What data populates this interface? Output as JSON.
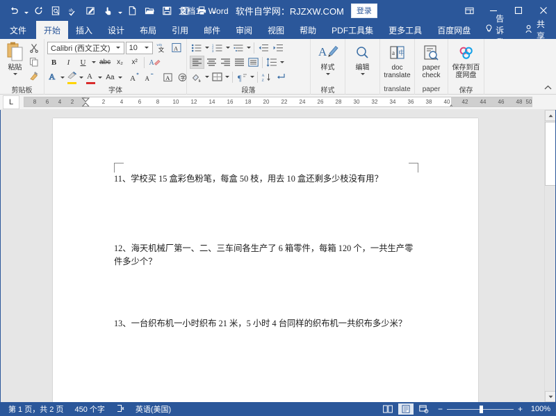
{
  "titlebar": {
    "quick_access": [
      {
        "name": "undo-icon",
        "label": "撤销"
      },
      {
        "name": "undo-dropdown-icon",
        "label": "撤销下拉"
      },
      {
        "name": "redo-icon",
        "label": "重复"
      },
      {
        "name": "print-preview-icon",
        "label": "打印预览"
      },
      {
        "name": "spelling-check-icon",
        "label": "拼写检查"
      },
      {
        "name": "edit-icon",
        "label": "编辑"
      },
      {
        "name": "touch-mode-icon",
        "label": "触摸模式"
      },
      {
        "name": "touch-dropdown-icon",
        "label": "触摸模式下拉"
      },
      {
        "name": "new-document-icon",
        "label": "新建"
      },
      {
        "name": "open-folder-icon",
        "label": "打开"
      },
      {
        "name": "save-icon",
        "label": "保存"
      },
      {
        "name": "attach-icon",
        "label": "附件"
      },
      {
        "name": "print-icon",
        "label": "打印"
      },
      {
        "name": "customize-qat-icon",
        "label": "自定义快速访问工具栏"
      }
    ],
    "document_title": "文档1  -  Word",
    "site_title": "软件自学网：RJZXW.COM",
    "signin_label": "登录",
    "window_buttons": [
      {
        "name": "ribbon-display-options-icon",
        "label": "功能区显示选项"
      },
      {
        "name": "minimize-icon",
        "label": "最小化"
      },
      {
        "name": "maximize-icon",
        "label": "最大化"
      },
      {
        "name": "close-icon",
        "label": "关闭"
      }
    ]
  },
  "tabs": [
    {
      "label": "文件",
      "active": false
    },
    {
      "label": "开始",
      "active": true
    },
    {
      "label": "插入",
      "active": false
    },
    {
      "label": "设计",
      "active": false
    },
    {
      "label": "布局",
      "active": false
    },
    {
      "label": "引用",
      "active": false
    },
    {
      "label": "邮件",
      "active": false
    },
    {
      "label": "审阅",
      "active": false
    },
    {
      "label": "视图",
      "active": false
    },
    {
      "label": "帮助",
      "active": false
    },
    {
      "label": "PDF工具集",
      "active": false
    },
    {
      "label": "更多工具",
      "active": false
    },
    {
      "label": "百度网盘",
      "active": false
    }
  ],
  "tab_right": {
    "tell_me": "告诉我",
    "share": "共享"
  },
  "ribbon": {
    "clipboard": {
      "group_label": "剪贴板",
      "paste_label": "粘贴",
      "cut_label": "剪切",
      "copy_label": "复制",
      "format_painter_label": "格式刷"
    },
    "font": {
      "group_label": "字体",
      "font_name": "Calibri (西文正文)",
      "font_size": "10",
      "bold": "B",
      "italic": "I",
      "underline": "U",
      "strikethrough": "abc",
      "subscript": "x₂",
      "superscript": "x²",
      "clear_format_label": "清除所有格式",
      "text_effects_label": "文本效果",
      "highlight_label": "以不同颜色突出显示文本",
      "font_color_label": "字体颜色",
      "change_case": "Aa",
      "grow_font": "A",
      "shrink_font": "A",
      "phonetic_guide_label": "拼音指南",
      "enclose_char_label": "字符边框",
      "text_highlight_color": "#ffd400",
      "font_color": "#d92b2b"
    },
    "paragraph": {
      "group_label": "段落",
      "bullets_label": "项目符号",
      "numbering_label": "编号",
      "multilevel_label": "多级列表",
      "decrease_indent_label": "减少缩进量",
      "increase_indent_label": "增加缩进量",
      "align_left_label": "左对齐",
      "align_center_label": "居中",
      "align_right_label": "右对齐",
      "justify_label": "两端对齐",
      "distribute_label": "分散对齐",
      "line_spacing_label": "行和段落间距",
      "shading_label": "底纹",
      "borders_label": "边框",
      "sort_label": "排序",
      "show_marks_label": "显示编辑标记"
    },
    "styles": {
      "group_label": "样式",
      "button_label": "样式"
    },
    "editing": {
      "group_label": "",
      "button_label": "编辑"
    },
    "translate": {
      "group_label": "translate",
      "button_label": "doc translate"
    },
    "paper": {
      "group_label": "paper",
      "button_label": "paper check"
    },
    "save": {
      "group_label": "保存",
      "button_label": "保存到百度网盘"
    },
    "collapse_label": "折叠功能区"
  },
  "ruler": {
    "tab_stop_marker": "L",
    "left_ticks": [
      8,
      6,
      4,
      2
    ],
    "right_ticks": [
      2,
      4,
      6,
      8,
      10,
      12,
      14,
      16,
      18,
      20,
      22,
      24,
      26,
      28,
      30,
      32,
      34,
      36,
      38,
      40
    ],
    "tail_ticks": [
      42,
      44,
      46,
      48,
      50
    ]
  },
  "document": {
    "paragraphs": [
      "11、学校买 15 盒彩色粉笔，每盒 50 枝，用去 10 盒还剩多少枝没有用？",
      "12、海天机械厂第一、二、三车间各生产了 6 箱零件，每箱 120 个，一共生产零件多少个？",
      "13、一台织布机一小时织布 21 米，5 小时 4 台同样的织布机一共织布多少米？"
    ]
  },
  "statusbar": {
    "page_info": "第 1 页，共 2 页",
    "word_count": "450 个字",
    "proofing_icon_label": "校对错误",
    "language": "英语(美国)",
    "view_buttons": [
      {
        "name": "read-mode-icon",
        "label": "阅读视图",
        "active": false
      },
      {
        "name": "print-layout-icon",
        "label": "页面视图",
        "active": true
      },
      {
        "name": "web-layout-icon",
        "label": "Web 版式视图",
        "active": false
      }
    ],
    "zoom_out": "−",
    "zoom_in": "+",
    "zoom_level": "100%"
  }
}
